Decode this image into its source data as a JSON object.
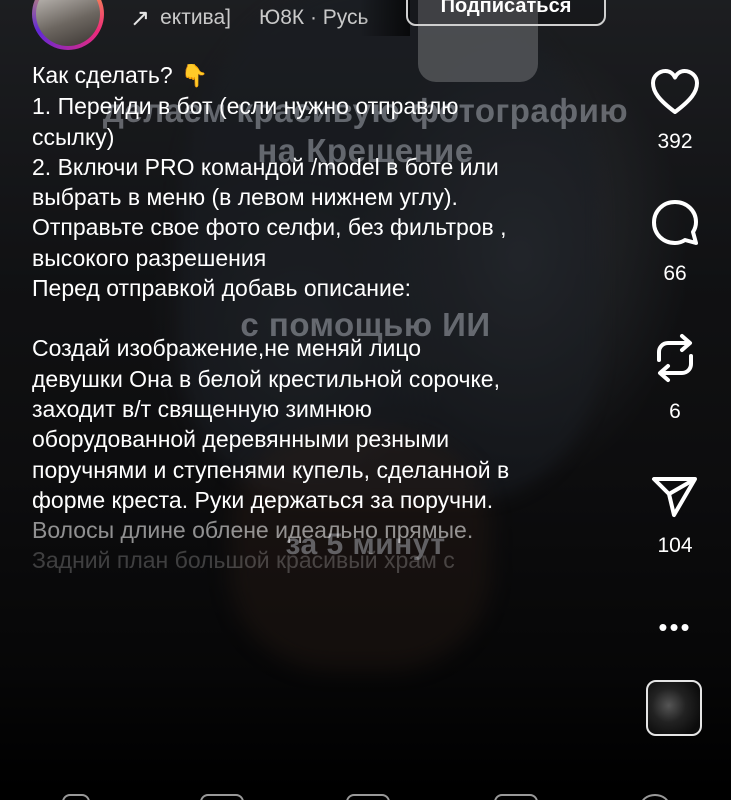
{
  "header": {
    "music_track": "ектива]",
    "music_artist": "Ю8К · Русь",
    "subscribe_label": "Подписаться"
  },
  "overlay": {
    "line1": "делаем красивую фотографию",
    "line2": "на Крещение",
    "line3": "с помощью ИИ",
    "line4": "за 5 минут"
  },
  "caption": {
    "lines": [
      "Как сделать?",
      "1. Перейди в бот (если нужно отправлю",
      "ссылку)",
      "2. Включи PRO командой /model в боте или",
      "выбрать в меню (в левом нижнем углу).",
      "Отправьте свое фото селфи, без фильтров ,",
      "высокого разрешения",
      "Перед отправкой добавь описание:",
      "",
      "Создай изображение,не меняй лицо",
      "девушки Она в белой крестильной сорочке,",
      "заходит в/т священную зимнюю",
      "оборудованной деревянными резными",
      "поручнями и ступенями купель, сделанной в",
      "форме креста. Руки держаться за поручни.",
      "Волосы длине облене идеально прямые.",
      "Задний план большой красивый храм с"
    ],
    "hand_emoji": "👇"
  },
  "actions": {
    "likes": "392",
    "comments": "66",
    "reposts": "6",
    "shares": "104",
    "more": "•••"
  },
  "colors": {
    "accent_ring": "#ee2a7b",
    "text": "#ffffff"
  },
  "icons": [
    "heart-icon",
    "comment-icon",
    "repost-icon",
    "send-icon",
    "more-icon"
  ]
}
